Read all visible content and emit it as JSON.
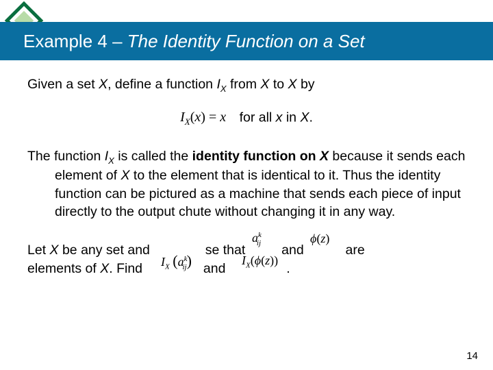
{
  "title": {
    "prefix": "Example 4",
    "dash": " – ",
    "subtitle": "The Identity Function on a Set"
  },
  "p1": {
    "t1": "Given a set ",
    "X": "X",
    "t2": ", define a function ",
    "I": "I",
    "Xsub": "X",
    "t3": " from ",
    "t4": " to ",
    "t5": " by"
  },
  "eq": {
    "img": "I",
    "imgSubX": "X",
    "imgParenOpen": "(",
    "imgVar": "x",
    "imgParenClose": ")",
    "imgEq": " = ",
    "imgRhs": "x",
    "after1": "for all ",
    "x": "x",
    "after2": " in ",
    "X": "X",
    "after3": "."
  },
  "p2": {
    "t1": "The function ",
    "I": "I",
    "Xsub": "X",
    "t2": " is called the ",
    "bold1": "identity function on ",
    "boldX": "X",
    "t3": " because it sends each element of ",
    "X": "X",
    "t4": " to the element that is identical to it. Thus the identity function can be pictured as a machine that sends each piece of input directly to the output chute without changing it in any way."
  },
  "p3": {
    "t1": "Let ",
    "X": "X",
    "t2": " be any set and",
    "t3": "se that",
    "t4": "and",
    "t5": "are",
    "t6": "elements of ",
    "t7": ". Find",
    "t8": "and",
    "t9": "."
  },
  "frag": {
    "a": "a",
    "i": "i",
    "j": "j",
    "k": "k",
    "phi": "ϕ",
    "z": "z",
    "I": "I",
    "X": "X"
  },
  "pagenum": "14"
}
